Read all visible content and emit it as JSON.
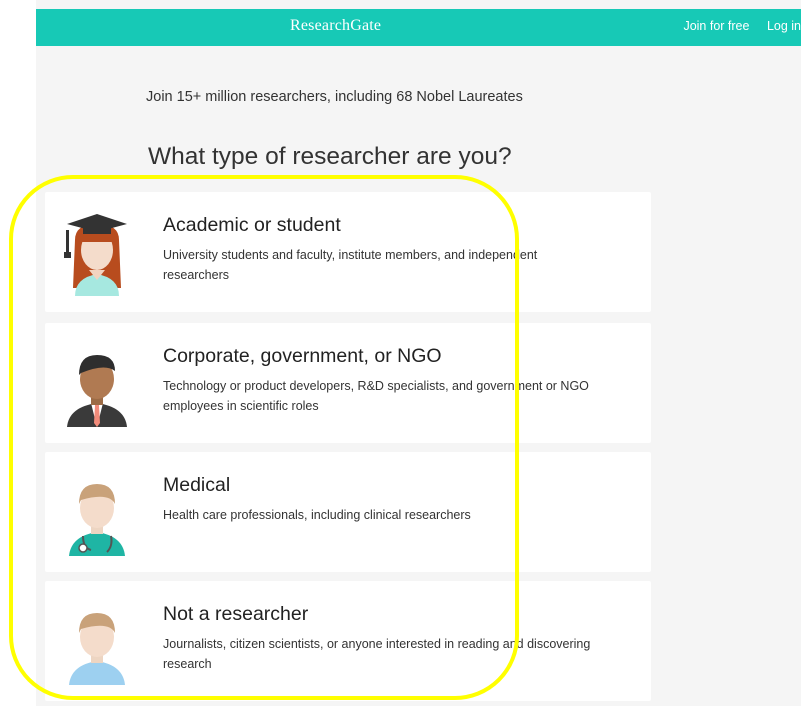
{
  "header": {
    "brand": "ResearchGate",
    "join_label": "Join for free",
    "login_label": "Log in"
  },
  "main": {
    "tagline": "Join 15+ million researchers, including 68 Nobel Laureates",
    "heading": "What type of researcher are you?",
    "options": [
      {
        "title": "Academic or student",
        "description": "University students and faculty, institute members, and independent researchers",
        "icon": "graduate-avatar-icon"
      },
      {
        "title": "Corporate, government, or NGO",
        "description": "Technology or product developers, R&D specialists, and government or NGO employees in scientific roles",
        "icon": "business-avatar-icon"
      },
      {
        "title": "Medical",
        "description": "Health care professionals, including clinical researchers",
        "icon": "doctor-avatar-icon"
      },
      {
        "title": "Not a researcher",
        "description": "Journalists, citizen scientists, or anyone interested in reading and discovering research",
        "icon": "person-avatar-icon"
      }
    ]
  },
  "colors": {
    "brand": "#17c9b6",
    "background": "#f5f5f5",
    "highlight": "#ffff00"
  }
}
